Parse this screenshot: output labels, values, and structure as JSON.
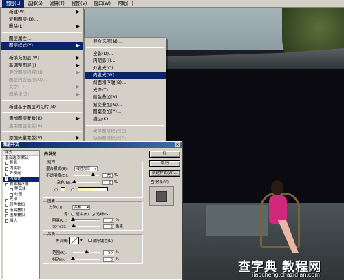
{
  "menubar": {
    "items": [
      "图层(L)",
      "选择(S)",
      "滤镜(T)",
      "视图(V)",
      "窗口(W)",
      "帮助(H)"
    ],
    "active_index": 0
  },
  "layer_menu": {
    "items": [
      {
        "label": "新建(W)",
        "arrow": "▶",
        "disabled": false
      },
      {
        "label": "复制图层(D)...",
        "arrow": "",
        "disabled": false
      },
      {
        "label": "删除(L)",
        "arrow": "▶",
        "disabled": false
      },
      {
        "sep": true
      },
      {
        "label": "图层属性...",
        "arrow": "",
        "disabled": false
      },
      {
        "label": "图层样式(Y)",
        "arrow": "▶",
        "disabled": false,
        "selected": true
      },
      {
        "sep": true
      },
      {
        "label": "新填充图层(W)",
        "arrow": "▶",
        "disabled": false
      },
      {
        "label": "新调整图层(J)",
        "arrow": "▶",
        "disabled": false
      },
      {
        "label": "更改图层内容(H)",
        "arrow": "▶",
        "disabled": true
      },
      {
        "label": "图层内容选项(O)...",
        "arrow": "",
        "disabled": true
      },
      {
        "label": "文字(T)",
        "arrow": "▶",
        "disabled": true
      },
      {
        "label": "栅格化(Z)",
        "arrow": "▶",
        "disabled": true
      },
      {
        "sep": true
      },
      {
        "label": "新建基于图层的切片(B)",
        "arrow": "",
        "disabled": false
      },
      {
        "sep": true
      },
      {
        "label": "添加图层蒙版(K)",
        "arrow": "▶",
        "disabled": false
      },
      {
        "label": "启用图层蒙版(B)",
        "arrow": "",
        "disabled": true
      },
      {
        "sep": true
      },
      {
        "label": "添加矢量蒙版(V)",
        "arrow": "▶",
        "disabled": false
      },
      {
        "label": "启用矢量蒙版(H)",
        "arrow": "",
        "disabled": true
      }
    ]
  },
  "style_submenu": {
    "items": [
      {
        "label": "混合选项(N)...",
        "disabled": false
      },
      {
        "sep": true
      },
      {
        "label": "投影(D)...",
        "disabled": false
      },
      {
        "label": "内阴影(I)...",
        "disabled": false
      },
      {
        "label": "外发光(O)...",
        "disabled": false
      },
      {
        "label": "内发光(W)...",
        "disabled": false,
        "selected": true
      },
      {
        "label": "斜面和浮雕(B)...",
        "disabled": false
      },
      {
        "label": "光泽(T)...",
        "disabled": false
      },
      {
        "label": "颜色叠加(V)...",
        "disabled": false
      },
      {
        "label": "渐变叠加(G)...",
        "disabled": false
      },
      {
        "label": "图案叠加(Y)...",
        "disabled": false
      },
      {
        "label": "描边(K)...",
        "disabled": false
      },
      {
        "sep": true
      },
      {
        "label": "拷贝图层样式(C)",
        "disabled": true
      },
      {
        "label": "粘贴图层样式(P)",
        "disabled": true
      },
      {
        "label": "将图层样式粘贴到链接的图层",
        "disabled": true
      }
    ]
  },
  "dialog": {
    "title": "图层样式",
    "close": "×",
    "styles_header": "样式",
    "styles": [
      {
        "label": "混合选项:默认",
        "check": false,
        "nocb": true
      },
      {
        "label": "投影",
        "check": false
      },
      {
        "label": "内阴影",
        "check": false
      },
      {
        "label": "外发光",
        "check": false
      },
      {
        "label": "内发光",
        "check": true,
        "selected": true
      },
      {
        "label": "斜面和浮雕",
        "check": false
      },
      {
        "label": "等高线",
        "check": false,
        "indent": true
      },
      {
        "label": "纹理",
        "check": false,
        "indent": true
      },
      {
        "label": "光泽",
        "check": false
      },
      {
        "label": "颜色叠加",
        "check": false
      },
      {
        "label": "渐变叠加",
        "check": false
      },
      {
        "label": "图案叠加",
        "check": false
      },
      {
        "label": "描边",
        "check": false
      }
    ],
    "section_title": "内发光",
    "structure": {
      "title": "结构",
      "blend_label": "混合模式(B):",
      "blend_value": "线性加深",
      "opacity_label": "不透明度(O):",
      "opacity_value": "75",
      "opacity_level": 0.75,
      "noise_label": "杂色(N):",
      "noise_value": "0",
      "noise_level": 0,
      "unit": "%"
    },
    "elements": {
      "title": "图素",
      "method_label": "方法(Q):",
      "method_value": "柔和",
      "source_label": "源:",
      "center_label": "居中(E)",
      "edge_label": "边缘(G)",
      "choke_label": "阻塞(C):",
      "choke_value": "0",
      "choke_level": 0,
      "size_label": "大小(S):",
      "size_value": "5",
      "size_level": 0.03,
      "pct": "%",
      "px": "像素"
    },
    "quality": {
      "title": "品质",
      "contour_label": "等高线:",
      "antialias_label": "消除锯齿(L)",
      "range_label": "范围(R):",
      "range_value": "50",
      "range_level": 0.5,
      "jitter_label": "抖动(J):",
      "jitter_value": "0",
      "jitter_level": 0,
      "pct": "%"
    },
    "buttons": {
      "ok": "好",
      "cancel": "取消",
      "new_style": "新建样式(W)...",
      "preview": "预览(V)"
    }
  },
  "watermark": {
    "brand": "查字典 教程网",
    "url": "jiaocheng.chazidian.com"
  }
}
